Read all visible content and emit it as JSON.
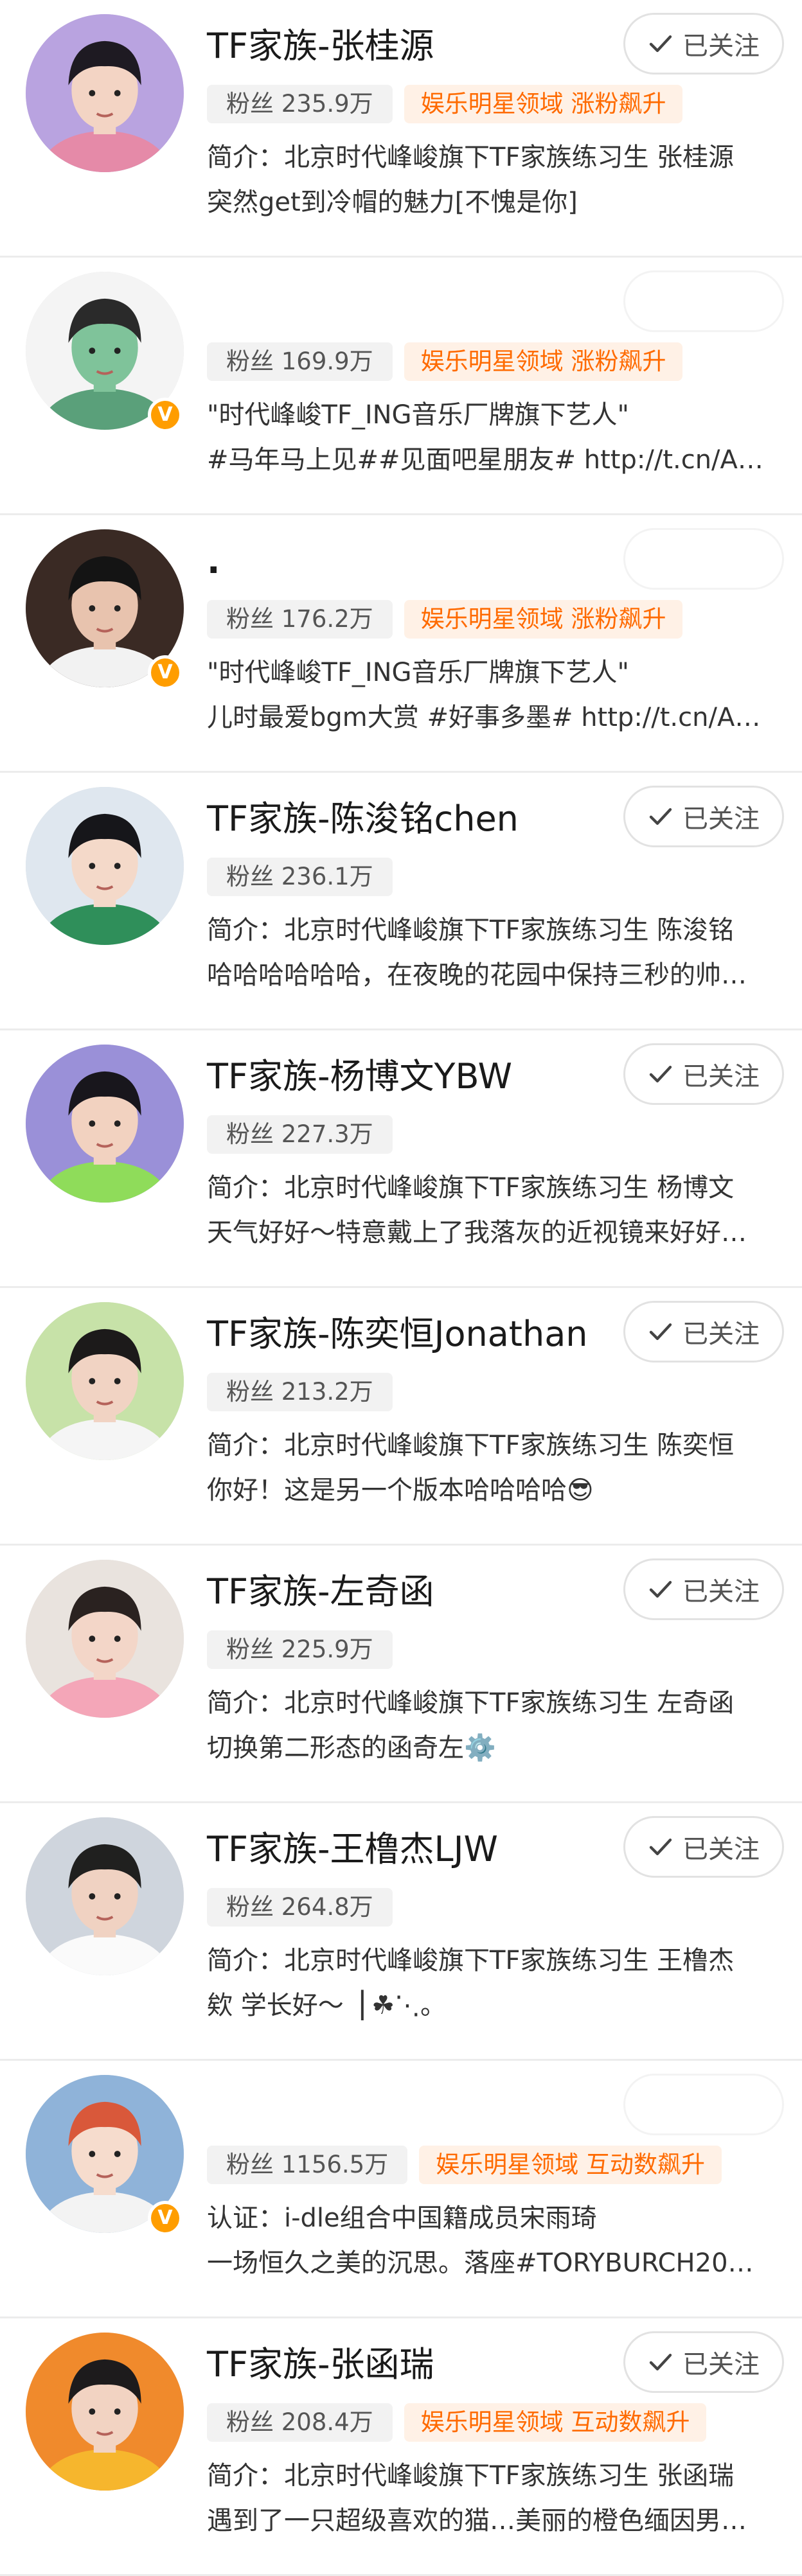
{
  "follow_label": "已关注",
  "users": [
    {
      "name": "TF家族-张桂源",
      "fans": "粉丝 235.9万",
      "domain": "娱乐明星领域 涨粉飙升",
      "desc1": "简介：北京时代峰峻旗下TF家族练习生 张桂源",
      "desc2": "突然get到冷帽的魅力[不愧是你]",
      "following": true,
      "verified": false,
      "avatar": {
        "bg": "#b9a3e0",
        "hair": "#1e1a22",
        "skin": "#f3d4c4",
        "shirt": "#e58aa8"
      }
    },
    {
      "name": "",
      "fans": "粉丝 169.9万",
      "domain": "娱乐明星领域 涨粉飙升",
      "desc1": "\"时代峰峻TF_ING音乐厂牌旗下艺人\"",
      "desc2": "#马年马上见##见面吧星朋友# http://t.cn/A…",
      "following": false,
      "verified": true,
      "avatar": {
        "bg": "#f4f4f4",
        "hair": "#2a2a2a",
        "skin": "#7fc39a",
        "shirt": "#5aa07a"
      }
    },
    {
      "name": ".",
      "fans": "粉丝 176.2万",
      "domain": "娱乐明星领域 涨粉飙升",
      "desc1": "\"时代峰峻TF_ING音乐厂牌旗下艺人\"",
      "desc2": "儿时最爱bgm大赏 #好事多墨# http://t.cn/A…",
      "following": false,
      "verified": true,
      "avatar": {
        "bg": "#3a2a24",
        "hair": "#141414",
        "skin": "#e8c3ae",
        "shirt": "#f2f2f2"
      }
    },
    {
      "name": "TF家族-陈浚铭chen",
      "fans": "粉丝 236.1万",
      "domain": "",
      "desc1": "简介：北京时代峰峻旗下TF家族练习生 陈浚铭",
      "desc2": "哈哈哈哈哈哈，在夜晚的花园中保持三秒的帅…",
      "following": true,
      "verified": false,
      "avatar": {
        "bg": "#dfe7ef",
        "hair": "#16161a",
        "skin": "#f4d9c9",
        "shirt": "#2f8f5a"
      }
    },
    {
      "name": "TF家族-杨博文YBW",
      "fans": "粉丝 227.3万",
      "domain": "",
      "desc1": "简介：北京时代峰峻旗下TF家族练习生 杨博文",
      "desc2": "天气好好～特意戴上了我落灰的近视镜来好好…",
      "following": true,
      "verified": false,
      "avatar": {
        "bg": "#9a90d8",
        "hair": "#18161c",
        "skin": "#f2d2c0",
        "shirt": "#8fdc5a"
      }
    },
    {
      "name": "TF家族-陈奕恒Jonathan",
      "fans": "粉丝 213.2万",
      "domain": "",
      "desc1": "简介：北京时代峰峻旗下TF家族练习生 陈奕恒",
      "desc2": "你好！这是另一个版本哈哈哈哈😎",
      "following": true,
      "verified": false,
      "avatar": {
        "bg": "#c7e2a8",
        "hair": "#1c1a1a",
        "skin": "#f1d3c3",
        "shirt": "#f5f5f5"
      }
    },
    {
      "name": "TF家族-左奇函",
      "fans": "粉丝 225.9万",
      "domain": "",
      "desc1": "简介：北京时代峰峻旗下TF家族练习生 左奇函",
      "desc2": "切换第二形态的函奇左⚙️",
      "following": true,
      "verified": false,
      "avatar": {
        "bg": "#e9e3de",
        "hair": "#2a2220",
        "skin": "#f3d6c8",
        "shirt": "#f4a6b8"
      }
    },
    {
      "name": "TF家族-王橹杰LJW",
      "fans": "粉丝 264.8万",
      "domain": "",
      "desc1": "简介：北京时代峰峻旗下TF家族练习生 王橹杰",
      "desc2": "欸 学长好～▕      ☘⋱。",
      "following": true,
      "verified": false,
      "avatar": {
        "bg": "#cfd5dd",
        "hair": "#20201f",
        "skin": "#f0d2c2",
        "shirt": "#fafafa"
      }
    },
    {
      "name": "",
      "fans": "粉丝 1156.5万",
      "domain": "娱乐明星领域 互动数飙升",
      "desc1": "认证：i-dle组合中国籍成员宋雨琦",
      "desc2": "一场恒久之美的沉思。落座#TORYBURCH20…",
      "following": false,
      "verified": true,
      "avatar": {
        "bg": "#8fb3d9",
        "hair": "#d9583a",
        "skin": "#f6dccd",
        "shirt": "#f3f3f3"
      }
    },
    {
      "name": "TF家族-张函瑞",
      "fans": "粉丝 208.4万",
      "domain": "娱乐明星领域 互动数飙升",
      "desc1": "简介：北京时代峰峻旗下TF家族练习生 张函瑞",
      "desc2": "遇到了一只超级喜欢的猫…美丽的橙色缅因男…",
      "following": true,
      "verified": false,
      "avatar": {
        "bg": "#f08a2c",
        "hair": "#1d1b1c",
        "skin": "#f2d3c2",
        "shirt": "#f6b62d"
      }
    }
  ]
}
